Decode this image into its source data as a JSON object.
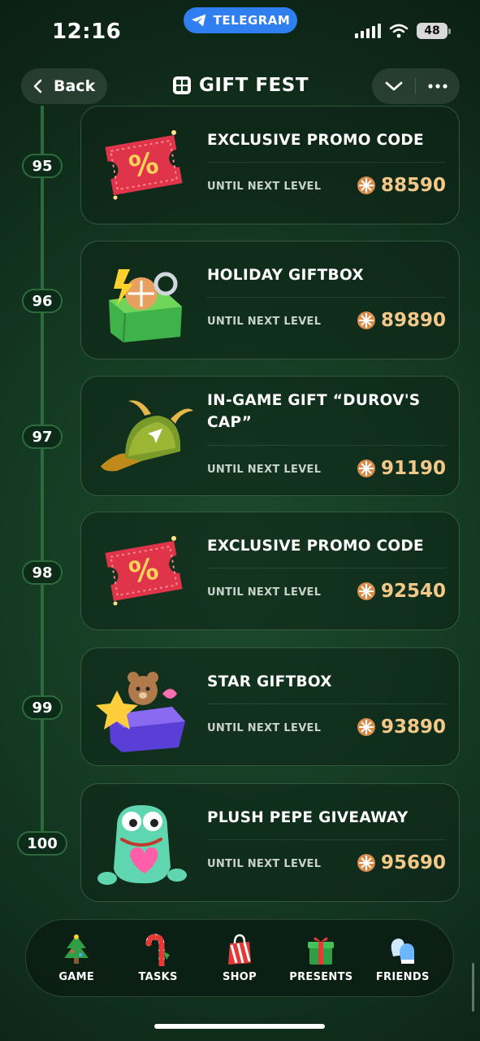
{
  "status_bar": {
    "time": "12:16",
    "telegram_label": "TELEGRAM",
    "battery": "48"
  },
  "header": {
    "back_label": "Back",
    "title": "GIFT FEST"
  },
  "levels": [
    {
      "level": "95",
      "name": "EXCLUSIVE PROMO CODE",
      "until_label": "UNTIL NEXT LEVEL",
      "cost": "88590",
      "icon": "promo-ticket-icon"
    },
    {
      "level": "96",
      "name": "HOLIDAY GIFTBOX",
      "until_label": "UNTIL NEXT LEVEL",
      "cost": "89890",
      "icon": "holiday-giftbox-icon"
    },
    {
      "level": "97",
      "name": "IN-GAME GIFT “DUROV'S CAP”",
      "until_label": "UNTIL NEXT LEVEL",
      "cost": "91190",
      "icon": "durov-cap-icon"
    },
    {
      "level": "98",
      "name": "EXCLUSIVE PROMO CODE",
      "until_label": "UNTIL NEXT LEVEL",
      "cost": "92540",
      "icon": "promo-ticket-icon"
    },
    {
      "level": "99",
      "name": "STAR GIFTBOX",
      "until_label": "UNTIL NEXT LEVEL",
      "cost": "93890",
      "icon": "star-giftbox-icon"
    },
    {
      "level": "100",
      "name": "PLUSH PEPE GIVEAWAY",
      "until_label": "UNTIL NEXT LEVEL",
      "cost": "95690",
      "icon": "plush-pepe-icon"
    }
  ],
  "nav": [
    {
      "label": "GAME",
      "icon": "christmas-tree-icon"
    },
    {
      "label": "TASKS",
      "icon": "candy-cane-icon"
    },
    {
      "label": "SHOP",
      "icon": "shopping-bag-icon"
    },
    {
      "label": "PRESENTS",
      "icon": "gift-icon"
    },
    {
      "label": "FRIENDS",
      "icon": "mittens-icon"
    }
  ],
  "colors": {
    "accent_cost": "#f3c98a",
    "telegram_blue": "#2f7ff0",
    "track": "#2d6b3d"
  }
}
